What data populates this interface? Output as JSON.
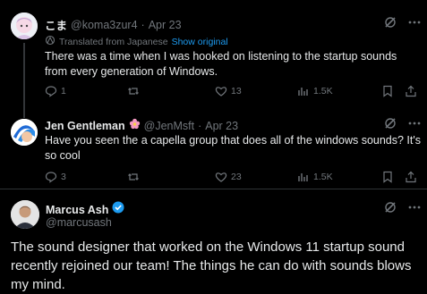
{
  "tweets": [
    {
      "name": "こま",
      "handle": "@koma3zur4",
      "date": "Apr 23",
      "translated_label": "Translated from Japanese",
      "show_original": "Show original",
      "text": "There was a time when I was hooked on listening to the startup sounds from every generation of Windows.",
      "reply_count": "1",
      "like_count": "13",
      "view_count": "1.5K"
    },
    {
      "name": "Jen Gentleman",
      "handle": "@JenMsft",
      "date": "Apr 23",
      "text": "Have you seen the a capella group that does all of the windows sounds? It's so cool",
      "reply_count": "3",
      "like_count": "23",
      "view_count": "1.5K"
    }
  ],
  "main_tweet": {
    "name": "Marcus Ash",
    "handle": "@marcusash",
    "text": "The sound designer that worked on the Windows 11 startup sound recently rejoined our team! The things he can do with sounds blows my mind."
  },
  "colors": {
    "background": "#000000",
    "text": "#e7e9ea",
    "muted": "#71767b",
    "link": "#1d9bf0",
    "verified": "#1d9bf0"
  },
  "icons": [
    "grok-icon",
    "more-icon",
    "translate-icon",
    "reply-icon",
    "retweet-icon",
    "like-icon",
    "views-icon",
    "bookmark-icon",
    "share-icon",
    "verified-icon",
    "flower-emoji"
  ]
}
